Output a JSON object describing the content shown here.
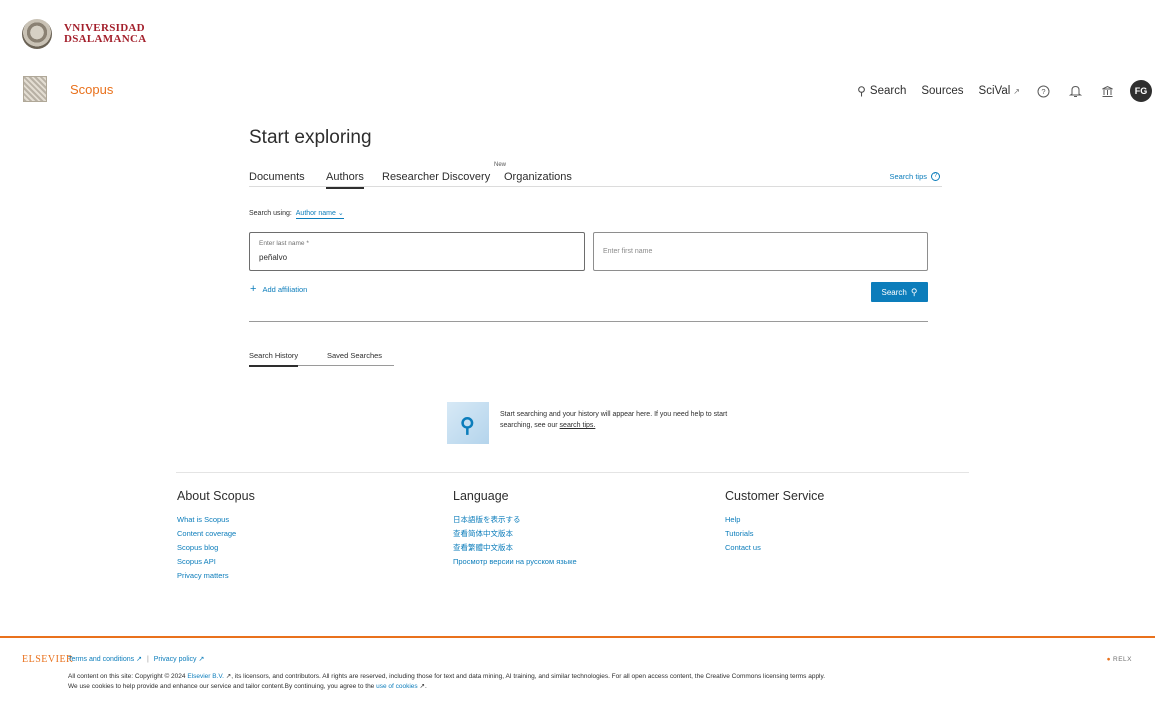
{
  "institution": {
    "name_line1": "VNIVERSIDAD",
    "name_line2": "DSALAMANCA"
  },
  "brand": {
    "name": "Scopus",
    "accent": "#e9711c",
    "link_color": "#0c7dbb"
  },
  "topnav": {
    "search_label": "Search",
    "sources_label": "Sources",
    "scival_label": "SciVal",
    "avatar_initials": "FG",
    "icons": [
      "search-icon",
      "external-link-icon",
      "help-icon",
      "bell-icon",
      "institution-icon"
    ]
  },
  "main": {
    "title": "Start exploring",
    "tabs": [
      {
        "label": "Documents",
        "active": false
      },
      {
        "label": "Authors",
        "active": true
      },
      {
        "label": "Researcher Discovery",
        "active": false,
        "badge": "New"
      },
      {
        "label": "Organizations",
        "active": false
      }
    ],
    "search_tips_label": "Search tips"
  },
  "form": {
    "search_using_label": "Search using:",
    "search_using_value": "Author name",
    "last_name_label": "Enter last name *",
    "last_name_value": "peñalvo",
    "first_name_placeholder": "Enter first name",
    "add_affiliation_label": "Add affiliation",
    "search_button_label": "Search"
  },
  "history": {
    "tabs": [
      {
        "label": "Search History",
        "active": true
      },
      {
        "label": "Saved Searches",
        "active": false
      }
    ],
    "empty_text": "Start searching and your history will appear here. If you need help to start searching, see our",
    "empty_link": "search tips."
  },
  "footer": {
    "about": {
      "heading": "About Scopus",
      "links": [
        "What is Scopus",
        "Content coverage",
        "Scopus blog",
        "Scopus API",
        "Privacy matters"
      ]
    },
    "language": {
      "heading": "Language",
      "links": [
        "日本語版を表示する",
        "查看简体中文版本",
        "查看繁體中文版本",
        "Просмотр версии на русском языке"
      ]
    },
    "customer_service": {
      "heading": "Customer Service",
      "links": [
        "Help",
        "Tutorials",
        "Contact us"
      ]
    },
    "elsevier_logo_text": "ELSEVIER",
    "terms_label": "Terms and conditions",
    "privacy_label": "Privacy policy",
    "relx_text": "RELX",
    "legal_part1": "All content on this site: Copyright © 2024",
    "legal_link1": "Elsevier B.V.",
    "legal_part2": ", its licensors, and contributors. All rights are reserved, including those for text and data mining, AI training, and similar technologies. For all open access content, the Creative Commons licensing terms apply.",
    "legal_part3": "We use cookies to help provide and enhance our service and tailor content.By continuing, you agree to the",
    "legal_link2": "use of cookies"
  }
}
